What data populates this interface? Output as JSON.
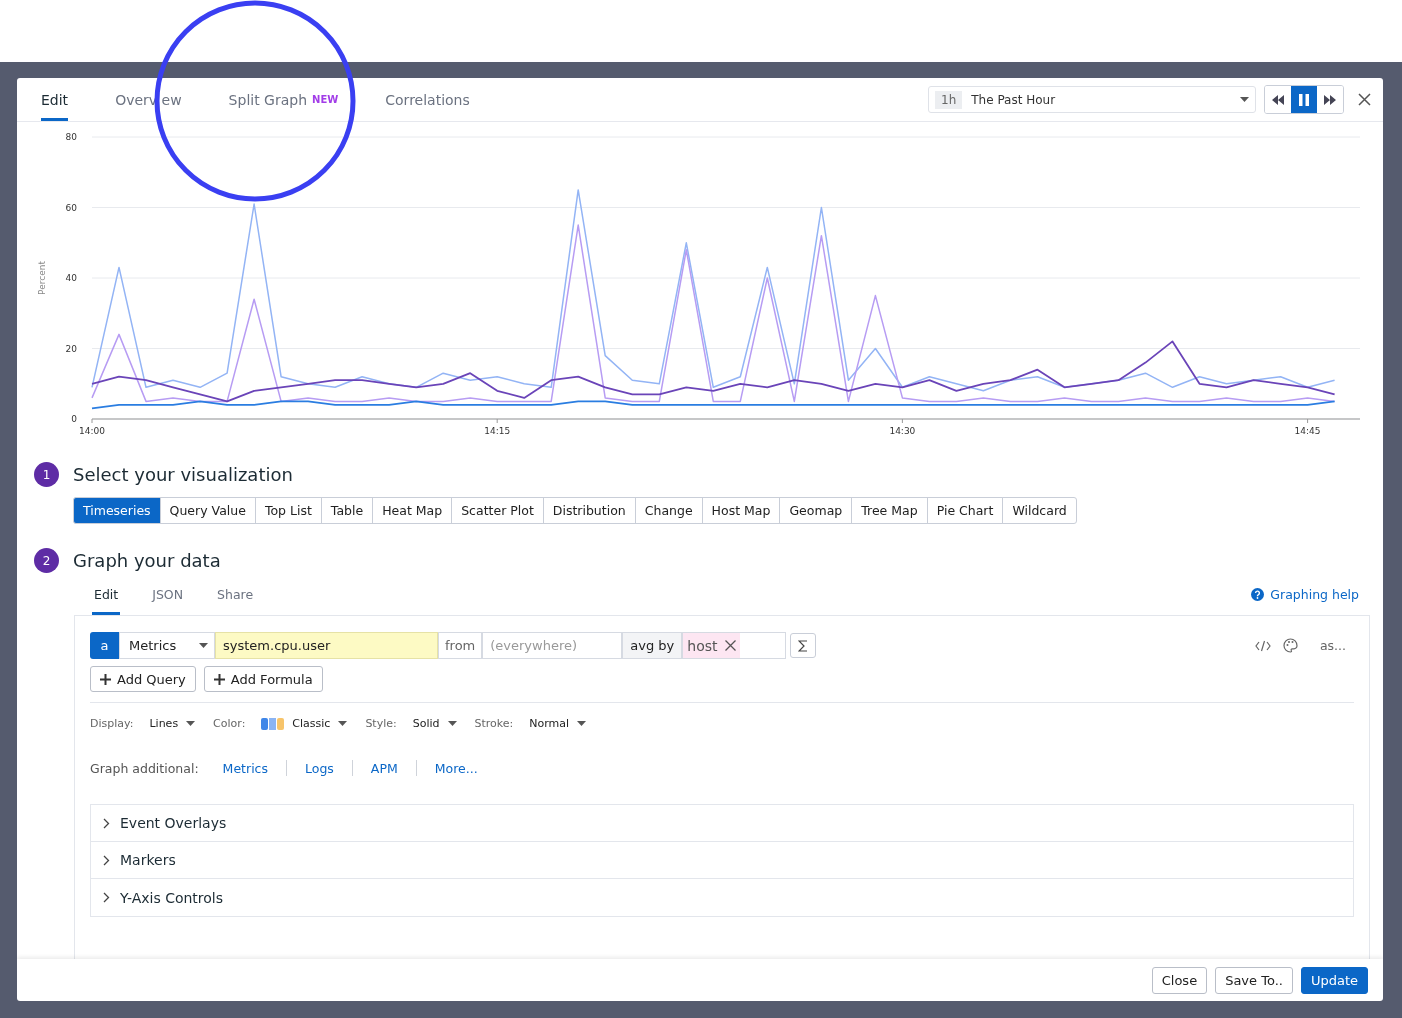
{
  "tabs": [
    {
      "label": "Edit",
      "selected": true
    },
    {
      "label": "Overv ew",
      "selected": false
    },
    {
      "label": "Split Graph",
      "badge": "NEW",
      "selected": false
    },
    {
      "label": "Correlations",
      "selected": false
    }
  ],
  "time_picker": {
    "badge": "1h",
    "value": "The Past Hour"
  },
  "playback": [
    {
      "kind": "rewind",
      "selected": false
    },
    {
      "kind": "pause",
      "selected": true
    },
    {
      "kind": "forward",
      "selected": false
    }
  ],
  "chart": {
    "chart_data": {
      "type": "line",
      "ylabel": "Percent",
      "categories": [
        "14:00",
        null,
        null,
        null,
        null,
        null,
        null,
        null,
        null,
        null,
        null,
        null,
        null,
        null,
        null,
        "14:15",
        null,
        null,
        null,
        null,
        null,
        null,
        null,
        null,
        null,
        null,
        null,
        null,
        null,
        null,
        "14:30",
        null,
        null,
        null,
        null,
        null,
        null,
        null,
        null,
        null,
        null,
        null,
        null,
        null,
        null,
        "14:45",
        null
      ],
      "ylim": [
        0,
        80
      ],
      "grid": true,
      "yticks": [
        0,
        20,
        40,
        60,
        80
      ],
      "series": [
        {
          "color": "#93b4f5",
          "values": [
            9,
            43,
            9,
            11,
            9,
            13,
            61,
            12,
            10,
            9,
            12,
            10,
            9,
            13,
            11,
            12,
            10,
            9,
            65,
            18,
            11,
            10,
            50,
            9,
            12,
            43,
            10,
            60,
            11,
            20,
            9,
            12,
            10,
            8,
            11,
            12,
            9,
            10,
            11,
            13,
            9,
            12,
            10,
            11,
            12,
            9,
            11
          ]
        },
        {
          "color": "#b79cf3",
          "values": [
            6,
            24,
            5,
            6,
            5,
            5,
            34,
            5,
            6,
            5,
            5,
            6,
            5,
            5,
            6,
            5,
            5,
            5,
            55,
            6,
            5,
            5,
            48,
            5,
            5,
            40,
            5,
            52,
            5,
            35,
            6,
            5,
            5,
            6,
            5,
            5,
            6,
            5,
            5,
            6,
            5,
            5,
            6,
            5,
            5,
            6,
            5
          ]
        },
        {
          "color": "#6a44b8",
          "values": [
            10,
            12,
            11,
            9,
            7,
            5,
            8,
            9,
            10,
            11,
            11,
            10,
            9,
            10,
            13,
            8,
            6,
            11,
            12,
            9,
            7,
            7,
            9,
            8,
            10,
            9,
            11,
            10,
            8,
            10,
            9,
            11,
            8,
            10,
            11,
            14,
            9,
            10,
            11,
            16,
            22,
            10,
            9,
            11,
            10,
            9,
            7
          ]
        },
        {
          "color": "#2a7de1",
          "values": [
            3,
            4,
            4,
            4,
            5,
            4,
            4,
            5,
            5,
            4,
            4,
            4,
            5,
            4,
            4,
            4,
            4,
            4,
            5,
            5,
            4,
            4,
            4,
            4,
            4,
            4,
            4,
            4,
            4,
            4,
            4,
            4,
            4,
            4,
            4,
            4,
            4,
            4,
            4,
            4,
            4,
            4,
            4,
            4,
            4,
            4,
            5
          ]
        }
      ]
    }
  },
  "visualization": {
    "number": "1",
    "title": "Select your visualization",
    "options": [
      {
        "label": "Timeseries",
        "selected": true
      },
      {
        "label": "Query Value",
        "selected": false
      },
      {
        "label": "Top List",
        "selected": false
      },
      {
        "label": "Table",
        "selected": false
      },
      {
        "label": "Heat Map",
        "selected": false
      },
      {
        "label": "Scatter Plot",
        "selected": false
      },
      {
        "label": "Distribution",
        "selected": false
      },
      {
        "label": "Change",
        "selected": false
      },
      {
        "label": "Host Map",
        "selected": false
      },
      {
        "label": "Geomap",
        "selected": false
      },
      {
        "label": "Tree Map",
        "selected": false
      },
      {
        "label": "Pie Chart",
        "selected": false
      },
      {
        "label": "Wildcard",
        "selected": false
      }
    ]
  },
  "graph": {
    "number": "2",
    "title": "Graph your data",
    "tabs": [
      {
        "label": "Edit",
        "selected": true
      },
      {
        "label": "JSON",
        "selected": false
      },
      {
        "label": "Share",
        "selected": false
      }
    ],
    "help": "Graphing help",
    "query": {
      "letter": "a",
      "source": "Metrics",
      "metric": "system.cpu.user",
      "from_label": "from",
      "from_placeholder": "(everywhere)",
      "aggregation": "avg by",
      "group": "host",
      "alias": "as..."
    },
    "buttons": [
      "Add Query",
      "Add Formula"
    ],
    "options": [
      {
        "label": "Display:",
        "value": "Lines",
        "kind": "plain"
      },
      {
        "label": "Color:",
        "value": "Classic",
        "kind": "palette"
      },
      {
        "label": "Style:",
        "value": "Solid",
        "kind": "plain"
      },
      {
        "label": "Stroke:",
        "value": "Normal",
        "kind": "plain"
      }
    ],
    "additional": {
      "label": "Graph additional:",
      "links": [
        "Metrics",
        "Logs",
        "APM",
        "More..."
      ]
    }
  },
  "sections": [
    {
      "title": "Event Overlays",
      "expanded": false
    },
    {
      "title": "Markers",
      "expanded": false
    },
    {
      "title": "Y-Axis Controls",
      "expanded": false
    }
  ],
  "footer": [
    {
      "label": "Close",
      "kind": "default"
    },
    {
      "label": "Save To..",
      "kind": "default"
    },
    {
      "label": "Update",
      "kind": "primary"
    }
  ]
}
